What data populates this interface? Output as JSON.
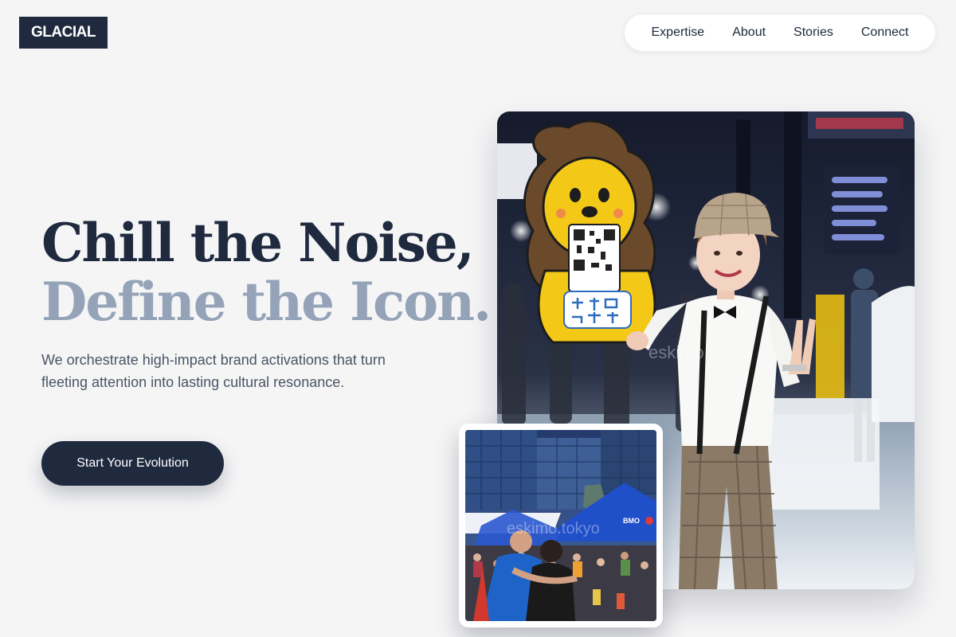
{
  "brand": {
    "logo_text": "GLACIAL"
  },
  "nav": {
    "items": [
      {
        "label": "Expertise"
      },
      {
        "label": "About"
      },
      {
        "label": "Stories"
      },
      {
        "label": "Connect"
      }
    ]
  },
  "hero": {
    "headline_line1": "Chill the Noise,",
    "headline_line2": "Define the Icon.",
    "subcopy": "We orchestrate high-impact brand activations that turn fleeting attention into lasting cultural resonance.",
    "cta_label": "Start Your Evolution"
  },
  "images": {
    "main_watermark": "eskimo.tokyo",
    "inset_watermark": "eskimo.tokyo",
    "inset_tent_label": "BMO"
  },
  "colors": {
    "primary_navy": "#1f2a3f",
    "muted_slate": "#94a3b8",
    "background": "#f5f5f6",
    "text_gray": "#4b5563"
  }
}
